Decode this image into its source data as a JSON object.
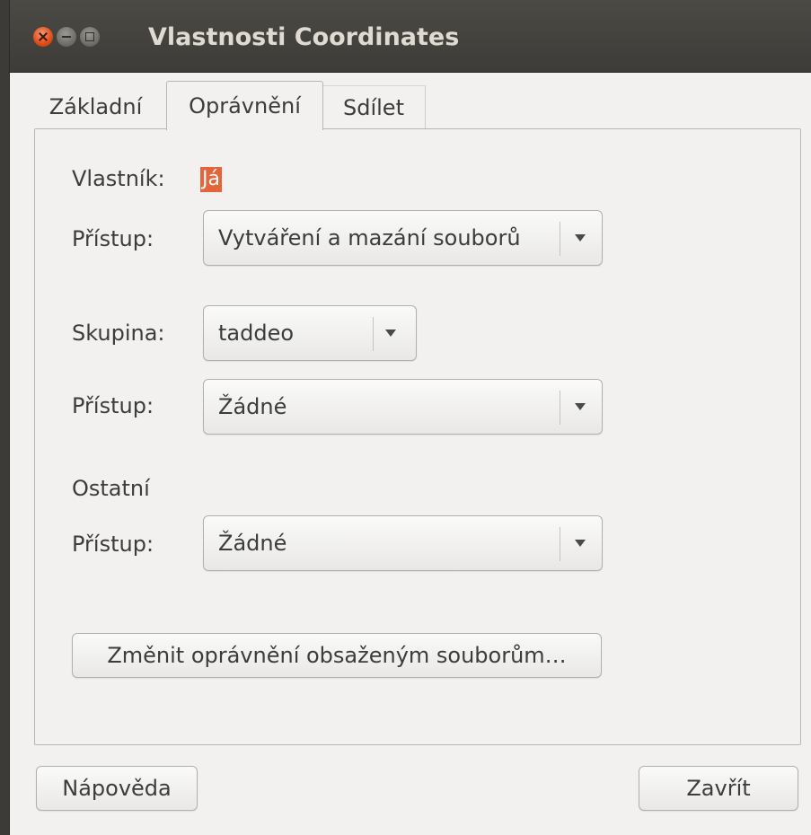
{
  "window": {
    "title": "Vlastnosti Coordinates"
  },
  "tabs": [
    {
      "label": "Základní",
      "active": false
    },
    {
      "label": "Oprávnění",
      "active": true
    },
    {
      "label": "Sdílet",
      "active": false
    }
  ],
  "owner": {
    "label": "Vlastník:",
    "value": "Já",
    "access_label": "Přístup:",
    "access_value": "Vytváření a mazání souborů"
  },
  "group": {
    "label": "Skupina:",
    "value": "taddeo",
    "access_label": "Přístup:",
    "access_value": "Žádné"
  },
  "others": {
    "label": "Ostatní",
    "access_label": "Přístup:",
    "access_value": "Žádné"
  },
  "change_button": "Změnit oprávnění obsaženým souborům…",
  "footer": {
    "help_button": "Nápověda",
    "close_button": "Zavřít"
  },
  "colors": {
    "selection": "#e4653a",
    "titlebar": "#3d3c38",
    "background": "#f2f1f0"
  }
}
